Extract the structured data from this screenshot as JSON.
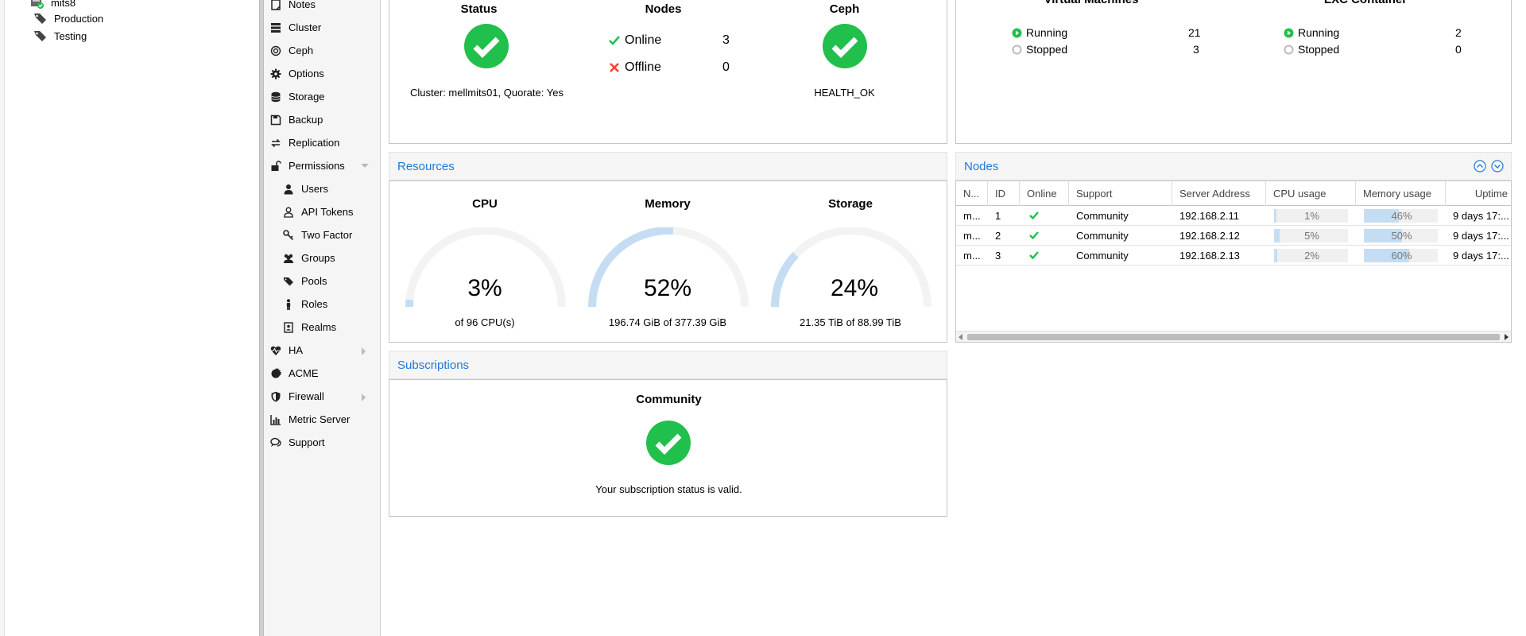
{
  "tree": {
    "items": [
      {
        "label": "mits8",
        "icon": "node-online-icon"
      },
      {
        "label": "Production",
        "icon": "tag-icon"
      },
      {
        "label": "Testing",
        "icon": "tag-icon"
      }
    ]
  },
  "menu": {
    "items": [
      {
        "label": "Notes",
        "icon": "notes-icon"
      },
      {
        "label": "Cluster",
        "icon": "cluster-icon"
      },
      {
        "label": "Ceph",
        "icon": "ceph-icon"
      },
      {
        "label": "Options",
        "icon": "gear-icon"
      },
      {
        "label": "Storage",
        "icon": "database-icon"
      },
      {
        "label": "Backup",
        "icon": "floppy-icon"
      },
      {
        "label": "Replication",
        "icon": "replication-icon"
      },
      {
        "label": "Permissions",
        "icon": "unlock-icon"
      },
      {
        "label": "Users",
        "icon": "user-icon"
      },
      {
        "label": "API Tokens",
        "icon": "user-outline-icon"
      },
      {
        "label": "Two Factor",
        "icon": "key-icon"
      },
      {
        "label": "Groups",
        "icon": "users-icon"
      },
      {
        "label": "Pools",
        "icon": "tags-icon"
      },
      {
        "label": "Roles",
        "icon": "male-icon"
      },
      {
        "label": "Realms",
        "icon": "address-book-icon"
      },
      {
        "label": "HA",
        "icon": "heartbeat-icon"
      },
      {
        "label": "ACME",
        "icon": "certificate-icon"
      },
      {
        "label": "Firewall",
        "icon": "shield-icon"
      },
      {
        "label": "Metric Server",
        "icon": "bar-chart-icon"
      },
      {
        "label": "Support",
        "icon": "comments-icon"
      }
    ]
  },
  "health": {
    "status_title": "Status",
    "cluster_text": "Cluster: mellmits01, Quorate: Yes",
    "nodes_title": "Nodes",
    "online_label": "Online",
    "online_count": "3",
    "offline_label": "Offline",
    "offline_count": "0",
    "ceph_title": "Ceph",
    "ceph_status": "HEALTH_OK"
  },
  "guests": {
    "vm_title": "Virtual Machines",
    "vm_running_label": "Running",
    "vm_running": "21",
    "vm_stopped_label": "Stopped",
    "vm_stopped": "3",
    "lxc_title": "LXC Container",
    "lxc_running_label": "Running",
    "lxc_running": "2",
    "lxc_stopped_label": "Stopped",
    "lxc_stopped": "0"
  },
  "resources": {
    "title": "Resources",
    "cpu": {
      "title": "CPU",
      "percent_text": "3%",
      "fraction": 0.03,
      "detail": "of 96 CPU(s)"
    },
    "memory": {
      "title": "Memory",
      "percent_text": "52%",
      "fraction": 0.52,
      "detail": "196.74 GiB of 377.39 GiB"
    },
    "storage": {
      "title": "Storage",
      "percent_text": "24%",
      "fraction": 0.24,
      "detail": "21.35 TiB of 88.99 TiB"
    }
  },
  "nodes_panel": {
    "title": "Nodes",
    "columns": [
      "N...",
      "ID",
      "Online",
      "Support",
      "Server Address",
      "CPU usage",
      "Memory usage",
      "Uptime"
    ],
    "rows": [
      {
        "name": "m...",
        "id": "1",
        "support": "Community",
        "address": "192.168.2.11",
        "cpu": 0.01,
        "cpu_text": "1%",
        "mem": 0.46,
        "mem_text": "46%",
        "uptime": "9 days 17:..."
      },
      {
        "name": "m...",
        "id": "2",
        "support": "Community",
        "address": "192.168.2.12",
        "cpu": 0.05,
        "cpu_text": "5%",
        "mem": 0.5,
        "mem_text": "50%",
        "uptime": "9 days 17:..."
      },
      {
        "name": "m...",
        "id": "3",
        "support": "Community",
        "address": "192.168.2.13",
        "cpu": 0.02,
        "cpu_text": "2%",
        "mem": 0.6,
        "mem_text": "60%",
        "uptime": "9 days 17:..."
      }
    ]
  },
  "subscriptions": {
    "title": "Subscriptions",
    "level": "Community",
    "message": "Your subscription status is valid."
  },
  "colors": {
    "accent": "#1e7ad6",
    "ok": "#21bf4b",
    "error": "#f44336",
    "gauge": "#c4ddf2",
    "gauge_bg": "#f3f3f3"
  }
}
